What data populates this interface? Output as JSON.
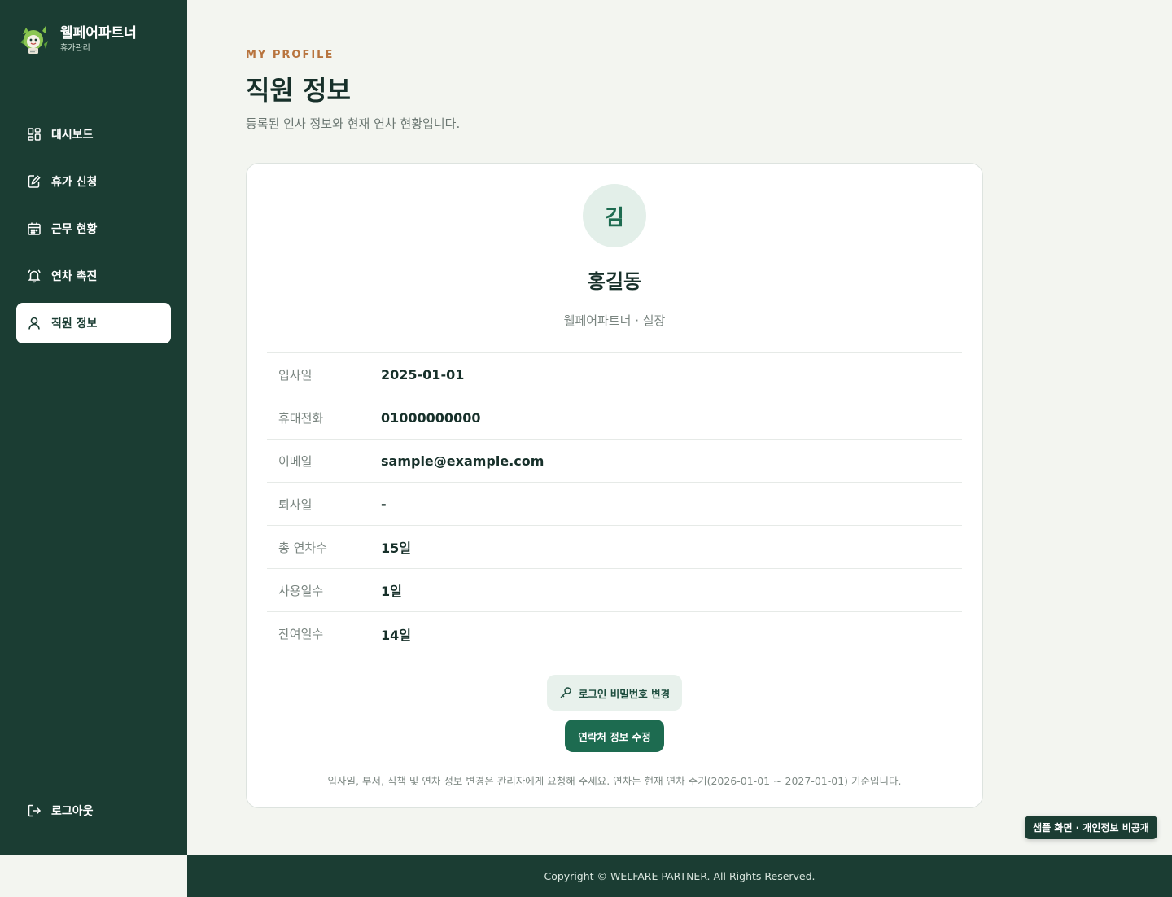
{
  "sidebar": {
    "brand": {
      "title": "웰페어파트너",
      "subtitle": "휴가관리"
    },
    "items": [
      {
        "label": "대시보드",
        "icon": "dashboard-icon"
      },
      {
        "label": "휴가 신청",
        "icon": "edit-document-icon"
      },
      {
        "label": "근무 현황",
        "icon": "calendar-icon"
      },
      {
        "label": "연차 촉진",
        "icon": "bell-icon"
      },
      {
        "label": "직원 정보",
        "icon": "user-icon",
        "active": true
      }
    ],
    "logout": {
      "label": "로그아웃",
      "icon": "logout-icon"
    }
  },
  "header": {
    "eyebrow": "MY PROFILE",
    "title": "직원 정보",
    "description": "등록된 인사 정보와 현재 연차 현황입니다."
  },
  "profile": {
    "avatar_initial": "김",
    "name": "홍길동",
    "organization": "웰페어파트너 · 실장",
    "fields": [
      {
        "label": "입사일",
        "value": "2025-01-01"
      },
      {
        "label": "휴대전화",
        "value": "01000000000"
      },
      {
        "label": "이메일",
        "value": "sample@example.com"
      },
      {
        "label": "퇴사일",
        "value": "-"
      },
      {
        "label": "총 연차수",
        "value": "15일"
      },
      {
        "label": "사용일수",
        "value": "1일"
      },
      {
        "label": "잔여일수",
        "value": "14일"
      }
    ]
  },
  "actions": {
    "change_password": "로그인 비밀번호 변경",
    "edit_contact": "연락처 정보 수정"
  },
  "notice": "입사일, 부서, 직책 및 연차 정보 변경은 관리자에게 요청해 주세요. 연차는 현재 연차 주기(2026-01-01 ~ 2027-01-01) 기준입니다.",
  "sample_badge": "샘플 화면 · 개인정보 비공개",
  "footer": "Copyright © WELFARE PARTNER. All Rights Reserved.",
  "colors": {
    "sidebar_bg": "#1b3d33",
    "accent_green": "#1d6b50",
    "eyebrow_orange": "#b8743e",
    "page_bg": "#f3f5f0"
  }
}
